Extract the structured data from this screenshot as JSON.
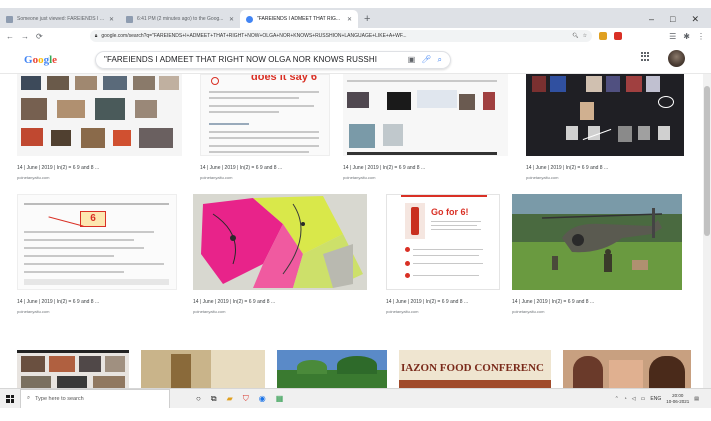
{
  "browser": {
    "tabs": [
      {
        "label": "Someone just viewed: FAREIENDS I A..."
      },
      {
        "label": "6:41 PM (2 minutes ago) to the Goog..."
      },
      {
        "label": "\"FAREIENDS I ADMEET THAT RIG...",
        "active": true
      }
    ],
    "new_tab": "+",
    "window_controls": [
      "–",
      "□",
      "✕"
    ],
    "url": "google.com/search?q=\"FAREIENDS+I+ADMEET+THAT+RIGHT+NOW+OLGA+NOR+KNOWS+RUSSHION+LANGUAGE+LIKE+A+WF..."
  },
  "google": {
    "logo_letters": [
      "G",
      "o",
      "o",
      "g",
      "l",
      "e"
    ],
    "logo_colors": [
      "#4285f4",
      "#ea4335",
      "#fbbc05",
      "#4285f4",
      "#34a853",
      "#ea4335"
    ],
    "query": "\"FAREIENDS I ADMEET THAT RIGHT NOW OLGA NOR KNOWS RUSSHI"
  },
  "results": [
    {
      "caption": "14 | June | 2019 | In(2) = 6 9 and 8 ...",
      "source": "poinetanyaltu.com"
    },
    {
      "caption": "14 | June | 2019 | In(2) = 6 9 and 8 ...",
      "source": "poinetanyaltu.com"
    },
    {
      "caption": "14 | June | 2019 | In(2) = 6 9 and 8 ...",
      "source": "poinetanyaltu.com"
    },
    {
      "caption": "14 | June | 2019 | In(2) = 6 9 and 8 ...",
      "source": "poinetanyaltu.com"
    },
    {
      "caption": "14 | June | 2019 | In(2) = 6 9 and 8 ...",
      "source": "poinetanyaltu.com"
    },
    {
      "caption": "14 | June | 2019 | In(2) = 6 9 and 8 ...",
      "source": "poinetanyaltu.com"
    },
    {
      "caption": "14 | June | 2019 | In(2) = 6 9 and 8 ...",
      "source": "poinetanyaltu.com"
    },
    {
      "caption": "14 | June | 2019 | In(2) = 6 9 and 8 ...",
      "source": "poinetanyaltu.com"
    }
  ],
  "thumb_text": {
    "does_it_say": "does it say 6",
    "number_six": "6",
    "go_for_six": "Go for 6!",
    "banner": "IAZON FOOD CONFERENC"
  },
  "taskbar": {
    "search_placeholder": "Type here to search",
    "lang": "ENG",
    "time": "20:00",
    "date": "10-06-2021"
  }
}
